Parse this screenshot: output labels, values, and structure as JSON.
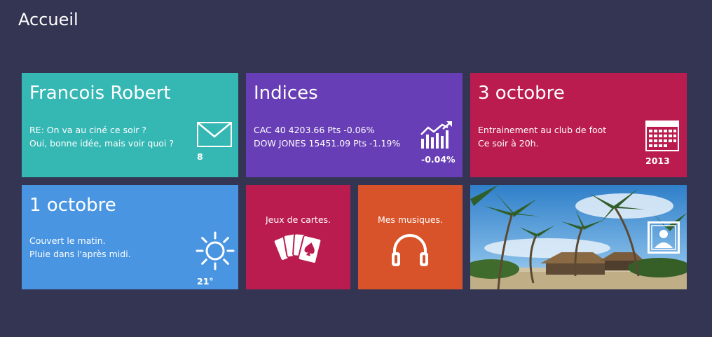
{
  "page": {
    "title": "Accueil"
  },
  "tiles": {
    "mail": {
      "title": "Francois Robert",
      "lines": [
        "RE: On va au ciné ce soir ?",
        "Oui, bonne idée, mais voir quoi ?"
      ],
      "count": "8",
      "icon": "envelope-icon",
      "color": "#35b7b4"
    },
    "indices": {
      "title": "Indices",
      "lines": [
        "CAC 40 4203.66 Pts -0.06%",
        "DOW JONES 15451.09 Pts -1.19%"
      ],
      "change": "-0.04%",
      "icon": "stock-chart-icon",
      "color": "#673eb5"
    },
    "calendar": {
      "title": "3 octobre",
      "lines": [
        "Entrainement au club de foot",
        "Ce soir à 20h."
      ],
      "year": "2013",
      "icon": "calendar-icon",
      "color": "#bb1c50"
    },
    "weather": {
      "title": "1 octobre",
      "lines": [
        "Couvert le matin.",
        "Pluie dans l'après midi."
      ],
      "temperature": "21°",
      "icon": "sun-icon",
      "color": "#4a95e2"
    },
    "cards": {
      "label": "Jeux de cartes.",
      "icon": "playing-cards-icon",
      "color": "#bb1c50"
    },
    "music": {
      "label": "Mes musiques.",
      "icon": "headphones-icon",
      "color": "#d8532a"
    },
    "photo": {
      "icon": "picture-icon"
    }
  }
}
